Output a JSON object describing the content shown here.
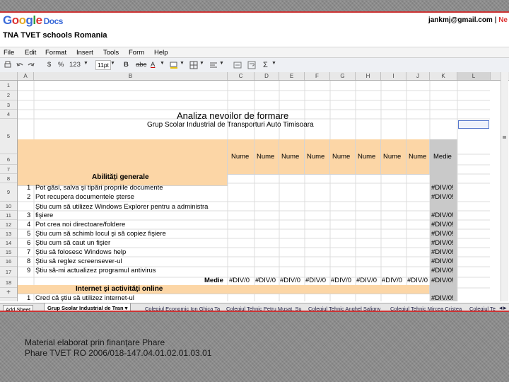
{
  "header": {
    "logo_letters": [
      "G",
      "o",
      "o",
      "g",
      "l",
      "e"
    ],
    "logo_suffix": "Docs",
    "doc_title": "TNA TVET schools Romania",
    "user_email": "jankmj@gmail.com",
    "separator": "|",
    "new_link": "Ne"
  },
  "menubar": {
    "items": [
      "File",
      "Edit",
      "Format",
      "Insert",
      "Tools",
      "Form",
      "Help"
    ]
  },
  "toolbar": {
    "currency": "$",
    "percent": "%",
    "number_format": "123",
    "font_size": "11pt",
    "bold": "B",
    "strike": "abc",
    "font_color": "A",
    "sigma": "Σ"
  },
  "columns": [
    "A",
    "B",
    "C",
    "D",
    "E",
    "F",
    "G",
    "H",
    "I",
    "J",
    "K",
    "L"
  ],
  "rows": [
    "1",
    "2",
    "3",
    "4",
    "5",
    "6",
    "7",
    "8",
    "9",
    "10",
    "11",
    "12",
    "13",
    "14",
    "15",
    "16",
    "17",
    "18"
  ],
  "sheet": {
    "title": "Analiza nevoilor de formare",
    "subtitle": "Grup Scolar Industrial de Transporturi Auto Timisoara",
    "name_headers": [
      "Nume",
      "Nume",
      "Nume",
      "Nume",
      "Nume",
      "Nume",
      "Nume",
      "Nume"
    ],
    "medie_header": "Medie",
    "section1": "Abilităţi generale",
    "section2": "Internet şi activităţi online",
    "medie_label": "Medie",
    "div_error": "#DIV/0!",
    "div_error_short": "#DIV/0",
    "items": [
      {
        "num": "1",
        "text": "Pot găsi, salva şi tipări propriile documente"
      },
      {
        "num": "2",
        "text": "Pot recupera documentele şterse"
      },
      {
        "num": "",
        "text": "Ştiu cum să utilizez Windows Explorer pentru a administra"
      },
      {
        "num": "3",
        "text": "fişiere"
      },
      {
        "num": "4",
        "text": "Pot crea noi directoare/foldere"
      },
      {
        "num": "5",
        "text": "Ştiu cum să schimb locul şi să copiez fişiere"
      },
      {
        "num": "6",
        "text": "Ştiu cum să caut un fişier"
      },
      {
        "num": "7",
        "text": "Ştiu să folosesc Windows help"
      },
      {
        "num": "8",
        "text": "Ştiu să reglez screensever-ul"
      },
      {
        "num": "9",
        "text": "Ştiu să-mi actualizez programul antivirus"
      },
      {
        "num": "1",
        "text": "Cred că ştiu să utilizez internet-ul"
      }
    ]
  },
  "sheet_tabs": {
    "add_sheet": "Add Sheet",
    "active": "Grup Scolar Industrial de Tran ▾",
    "others": [
      "Colegiul Economic Ion Ghica Ta",
      "Colegiul Tehnic Petru Musat, Su",
      "Colegiul Tehnic Anghel Saligny",
      "Colegiul Tehnic Mircea Cristea",
      "Colegiul Te"
    ]
  },
  "footer": {
    "line1": "Material elaborat prin finanţare Phare",
    "line2": "Phare TVET RO 2006/018-147.04.01.02.01.03.01"
  },
  "colors": {
    "frame_border": "#cc3333",
    "section_bg": "#fcd6a6",
    "medie_bg": "#c9c9c9",
    "selected_cell": "#5577cc",
    "background": "#8c8c8c"
  }
}
